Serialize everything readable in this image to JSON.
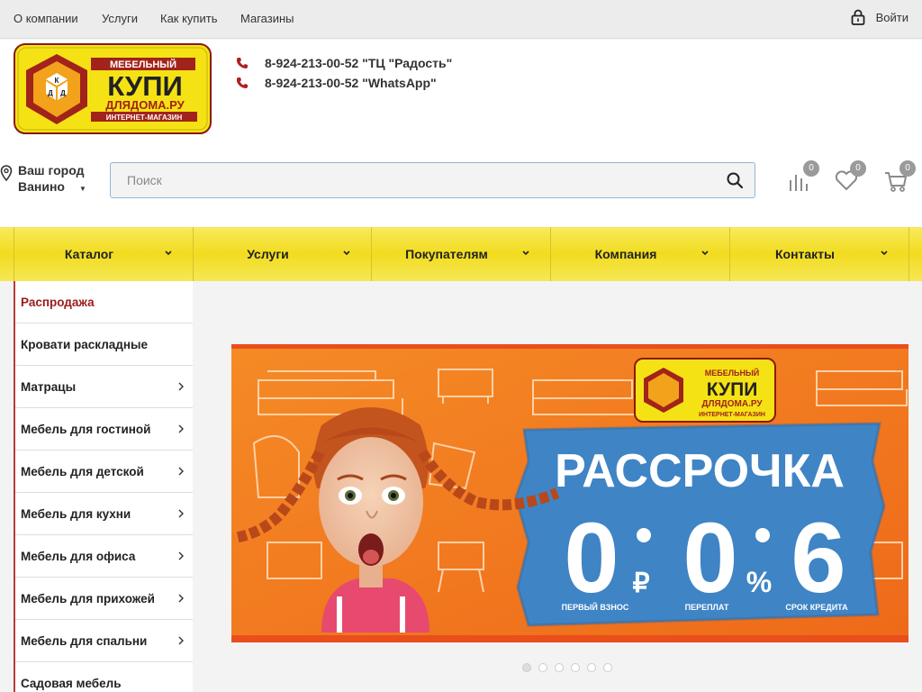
{
  "topnav": {
    "links": [
      "О компании",
      "Услуги",
      "Как купить",
      "Магазины"
    ],
    "login": "Войти"
  },
  "logo": {
    "line1": "МЕБЕЛЬНЫЙ",
    "line2": "КУПИ",
    "line3": "ДЛЯДОМА.РУ",
    "line4": "ИНТЕРНЕТ-МАГАЗИН",
    "mark": [
      "К",
      "Д",
      "Д"
    ]
  },
  "phones": [
    "8-924-213-00-52 \"ТЦ \"Радость\"",
    "8-924-213-00-52 \"WhatsApp\""
  ],
  "city": {
    "label": "Ваш город",
    "value": "Ванино"
  },
  "search": {
    "placeholder": "Поиск",
    "value": ""
  },
  "header_icons": [
    {
      "icon": "compare-icon",
      "count": "0"
    },
    {
      "icon": "heart-icon",
      "count": "0"
    },
    {
      "icon": "cart-icon",
      "count": "0"
    }
  ],
  "mainnav": [
    "Каталог",
    "Услуги",
    "Покупателям",
    "Компания",
    "Контакты"
  ],
  "sidebar": [
    {
      "label": "Распродажа",
      "has_arrow": false
    },
    {
      "label": "Кровати раскладные",
      "has_arrow": false
    },
    {
      "label": "Матрацы",
      "has_arrow": true
    },
    {
      "label": "Мебель для гостиной",
      "has_arrow": true
    },
    {
      "label": "Мебель для детской",
      "has_arrow": true
    },
    {
      "label": "Мебель для кухни",
      "has_arrow": true
    },
    {
      "label": "Мебель для офиса",
      "has_arrow": true
    },
    {
      "label": "Мебель для прихожей",
      "has_arrow": true
    },
    {
      "label": "Мебель для спальни",
      "has_arrow": true
    },
    {
      "label": "Садовая мебель",
      "has_arrow": false
    }
  ],
  "banner": {
    "headline": "РАССРОЧКА",
    "digit1": "0",
    "unit1": "₽",
    "digit2": "0",
    "unit2": "%",
    "digit3": "6",
    "caption1": "ПЕРВЫЙ ВЗНОС",
    "caption2": "ПЕРЕПЛАТ",
    "caption3": "СРОК КРЕДИТА"
  },
  "slider": {
    "dots": 6,
    "active": 0
  },
  "colors": {
    "nav_yellow": "#f2dc1f",
    "accent_red": "#9b1a1a",
    "banner_orange": "#f07a1f",
    "banner_blue": "#3f84c5"
  }
}
